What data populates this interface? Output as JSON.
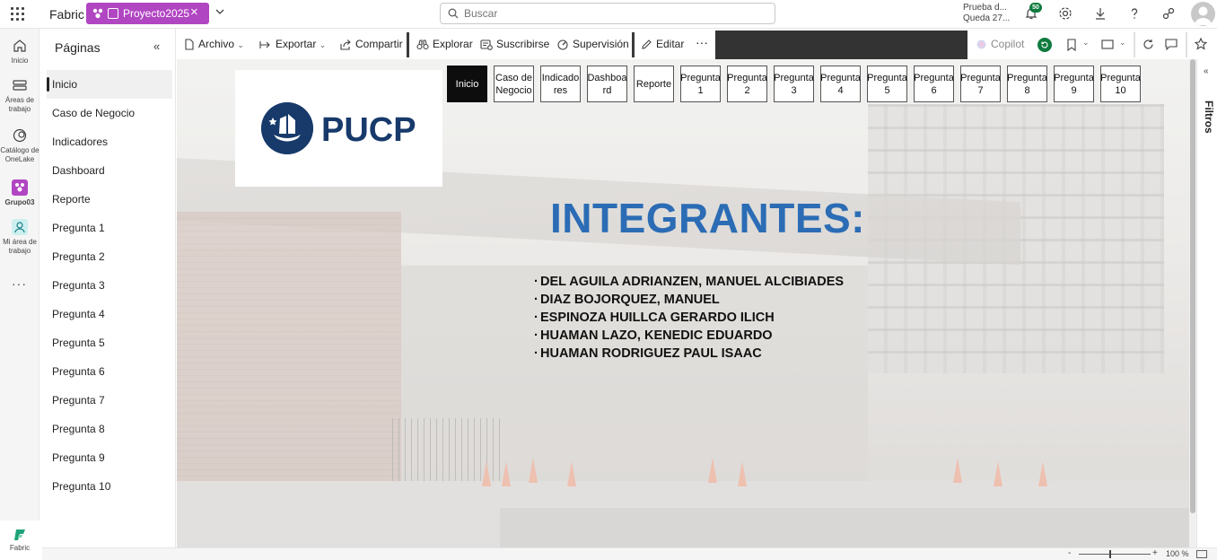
{
  "topbar": {
    "app_name": "Fabric",
    "workspace": "Proyecto2025",
    "search_placeholder": "Buscar",
    "trial_line1": "Prueba d...",
    "trial_line2": "Queda 27...",
    "notifications_count": "50"
  },
  "rail": {
    "home": "Inicio",
    "workspaces_1": "Áreas de",
    "workspaces_2": "trabajo",
    "onelake_1": "Catálogo de",
    "onelake_2": "OneLake",
    "group": "Grupo03",
    "my_ws_1": "Mi área de",
    "my_ws_2": "trabajo",
    "more": "···",
    "fabric": "Fabric"
  },
  "pages_pane": {
    "title": "Páginas",
    "items": [
      "Inicio",
      "Caso de Negocio",
      "Indicadores",
      "Dashboard",
      "Reporte",
      "Pregunta 1",
      "Pregunta 2",
      "Pregunta 3",
      "Pregunta 4",
      "Pregunta 5",
      "Pregunta 6",
      "Pregunta 7",
      "Pregunta 8",
      "Pregunta 9",
      "Pregunta 10"
    ]
  },
  "toolbar": {
    "file": "Archivo",
    "export": "Exportar",
    "share": "Compartir",
    "explore": "Explorar",
    "subscribe": "Suscribirse",
    "monitor": "Supervisión",
    "edit": "Editar",
    "more": "···",
    "copilot": "Copilot"
  },
  "report": {
    "logo_text": "PUCP",
    "nav_buttons": [
      {
        "l1": "Inicio",
        "l2": ""
      },
      {
        "l1": "Caso de",
        "l2": "Negocio"
      },
      {
        "l1": "Indicado",
        "l2": "res"
      },
      {
        "l1": "Dashboa",
        "l2": "rd"
      },
      {
        "l1": "Reporte",
        "l2": ""
      },
      {
        "l1": "Pregunta",
        "l2": "1"
      },
      {
        "l1": "Pregunta",
        "l2": "2"
      },
      {
        "l1": "Pregunta",
        "l2": "3"
      },
      {
        "l1": "Pregunta",
        "l2": "4"
      },
      {
        "l1": "Pregunta",
        "l2": "5"
      },
      {
        "l1": "Pregunta",
        "l2": "6"
      },
      {
        "l1": "Pregunta",
        "l2": "7"
      },
      {
        "l1": "Pregunta",
        "l2": "8"
      },
      {
        "l1": "Pregunta",
        "l2": "9"
      },
      {
        "l1": "Pregunta",
        "l2": "10"
      }
    ],
    "title": "INTEGRANTES:",
    "members": [
      "DEL AGUILA ADRIANZEN, MANUEL ALCIBIADES",
      "DIAZ BOJORQUEZ, MANUEL",
      "ESPINOZA HUILLCA GERARDO ILICH",
      "HUAMAN LAZO, KENEDIC EDUARDO",
      "HUAMAN RODRIGUEZ PAUL ISAAC"
    ]
  },
  "filters_label": "Filtros",
  "statusbar": {
    "zoom": "100 %",
    "zoom_minus": "-",
    "zoom_plus": "+"
  },
  "colors": {
    "workspace_pill": "#b146c2",
    "title_blue": "#2b6cb5",
    "pucp_navy": "#173a6b"
  }
}
